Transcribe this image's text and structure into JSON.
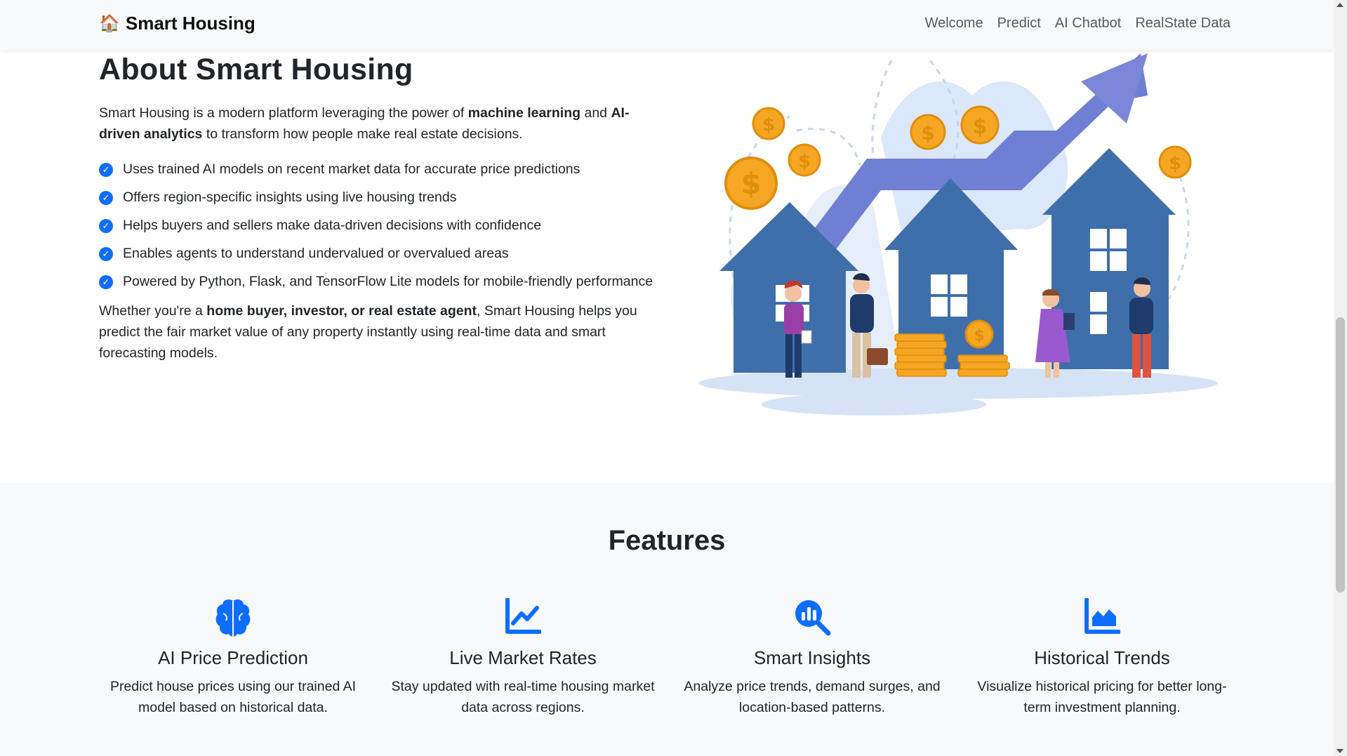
{
  "navbar": {
    "brand": "Smart Housing",
    "brand_icon": "house-emoji",
    "links": [
      "Welcome",
      "Predict",
      "AI Chatbot",
      "RealState Data"
    ]
  },
  "about": {
    "title": "About Smart Housing",
    "intro_1": "Smart Housing is a modern platform leveraging the power of ",
    "intro_bold_1": "machine learning",
    "intro_2": " and ",
    "intro_bold_2": "AI-driven analytics",
    "intro_3": " to transform how people make real estate decisions.",
    "points": [
      "Uses trained AI models on recent market data for accurate price predictions",
      "Offers region-specific insights using live housing trends",
      "Helps buyers and sellers make data-driven decisions with confidence",
      "Enables agents to understand undervalued or overvalued areas",
      "Powered by Python, Flask, and TensorFlow Lite models for mobile-friendly performance"
    ],
    "outro_1": "Whether you're a ",
    "outro_bold": "home buyer, investor, or real estate agent",
    "outro_2": ", Smart Housing helps you predict the fair market value of any property instantly using real-time data and smart forecasting models."
  },
  "features": {
    "title": "Features",
    "items": [
      {
        "icon": "brain-icon",
        "title": "AI Price Prediction",
        "desc": "Predict house prices using our trained AI model based on historical data."
      },
      {
        "icon": "line-chart-icon",
        "title": "Live Market Rates",
        "desc": "Stay updated with real-time housing market data across regions."
      },
      {
        "icon": "search-chart-icon",
        "title": "Smart Insights",
        "desc": "Analyze price trends, demand surges, and location-based patterns."
      },
      {
        "icon": "area-chart-icon",
        "title": "Historical Trends",
        "desc": "Visualize historical pricing for better long-term investment planning."
      }
    ]
  },
  "colors": {
    "accent": "#0d6efd",
    "navbar_bg": "#f8f9fa",
    "house_blue": "#3f6fab",
    "coin_gold": "#f5a623"
  }
}
